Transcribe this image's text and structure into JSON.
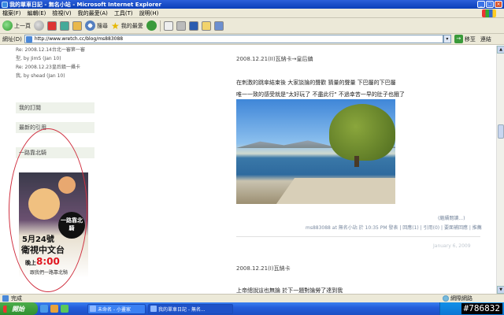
{
  "window": {
    "title": "我的單車日記 - 無名小站 - Microsoft Internet Explorer"
  },
  "menu": {
    "items": [
      "檔案(F)",
      "編輯(E)",
      "檢視(V)",
      "我的最愛(A)",
      "工具(T)",
      "說明(H)"
    ]
  },
  "toolbar": {
    "back_label": "上一頁",
    "search_label": "搜尋",
    "favorites_label": "我的最愛"
  },
  "address": {
    "label": "網址(D)",
    "url": "http://www.wretch.cc/blog/ms883088",
    "go_label": "移至",
    "links_label": "連結"
  },
  "sidebar": {
    "comments": [
      "Re: 2008.12.14台北一審第一審",
      "型, by JimS (Jan 10)",
      "Re: 2008.12.23皇后鎮一攝卡",
      "我, by shead (Jan 10)"
    ],
    "sections": [
      "我的訂閱",
      "最新的引用",
      "一路靠北騎"
    ],
    "promo": {
      "date": "5月24號",
      "channel": "衛視中文台",
      "time_prefix": "晚上",
      "time": "8:00",
      "subtitle": "跟我們一路靠北騎",
      "badge": "一路靠北騎"
    }
  },
  "posts": [
    {
      "title": "2008.12.21(II)瓦納卡→皇后鎮",
      "lines": [
        "在刺激的跳傘結束後 大家談論的聲歡 猜量的聲量 下巴屬的下巴屬",
        "唯一一致的感受就是\"太好玩了 不盡此行\" 不過幸苦一早的肚子也餓了"
      ],
      "read_more": "(繼續閱讀...)",
      "meta": "ms883088 at 無名小站 於 10:35 PM 發表 | 回應(1) | 引用(0) | 要面補回應 | 推薦"
    },
    {
      "date": "January 6, 2009",
      "title": "2008.12.21(I)瓦納卡",
      "lines": [
        "上帝總說這也無論 於下一題對論勞了達到我"
      ]
    }
  ],
  "status": {
    "text": "完成",
    "zone": "網際網路"
  },
  "taskbar": {
    "start": "開始",
    "tasks": [
      "未命名 - 小畫家",
      "我的單車日記 - 無名..."
    ],
    "watermark": "#786832"
  }
}
